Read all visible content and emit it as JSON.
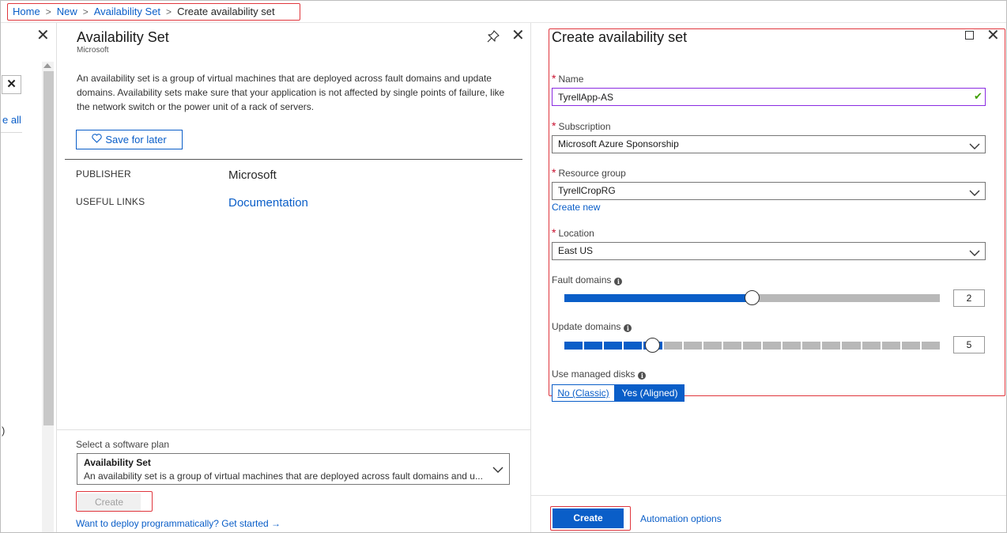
{
  "breadcrumb": {
    "items": [
      "Home",
      "New",
      "Availability Set"
    ],
    "current": "Create availability set"
  },
  "left_panel": {
    "link_fragment": "e all",
    "paren_fragment": ")"
  },
  "marketplace_blade": {
    "title": "Availability Set",
    "subtitle": "Microsoft",
    "description": "An availability set is a group of virtual machines that are deployed across fault domains and update domains. Availability sets make sure that your application is not affected by single points of failure, like the network switch or the power unit of a rack of servers.",
    "save_for_later": "Save for later",
    "publisher_label": "PUBLISHER",
    "publisher_value": "Microsoft",
    "useful_links_label": "USEFUL LINKS",
    "useful_links_value": "Documentation",
    "software_plan_label": "Select a software plan",
    "software_plan_title": "Availability Set",
    "software_plan_desc": "An availability set is a group of virtual machines that are deployed across fault domains and u...",
    "create_label": "Create",
    "deploy_link": "Want to deploy programmatically? Get started →"
  },
  "create_blade": {
    "title": "Create availability set",
    "name": {
      "label": "Name",
      "value": "TyrellApp-AS"
    },
    "subscription": {
      "label": "Subscription",
      "value": "Microsoft Azure Sponsorship"
    },
    "resource_group": {
      "label": "Resource group",
      "value": "TyrellCropRG",
      "create_new": "Create new"
    },
    "location": {
      "label": "Location",
      "value": "East US"
    },
    "fault_domains": {
      "label": "Fault domains",
      "value": "2",
      "fill_fraction": 0.5
    },
    "update_domains": {
      "label": "Update domains",
      "value": "5",
      "total_segments": 19
    },
    "managed_disks": {
      "label": "Use managed disks",
      "option_no": "No (Classic)",
      "option_yes": "Yes (Aligned)",
      "selected": "Yes (Aligned)"
    },
    "create_label": "Create",
    "automation_link": "Automation options"
  },
  "colors": {
    "accent": "#0a5ec8",
    "highlight_box": "#e0363d",
    "required": "#c8102e",
    "name_focus": "#8a2be2",
    "valid_check": "#3f9f00"
  },
  "icons": [
    "close-icon",
    "pin-icon",
    "maximize-icon",
    "heart-icon",
    "chevron-down-icon",
    "info-icon",
    "check-icon",
    "arrow-right-icon"
  ]
}
